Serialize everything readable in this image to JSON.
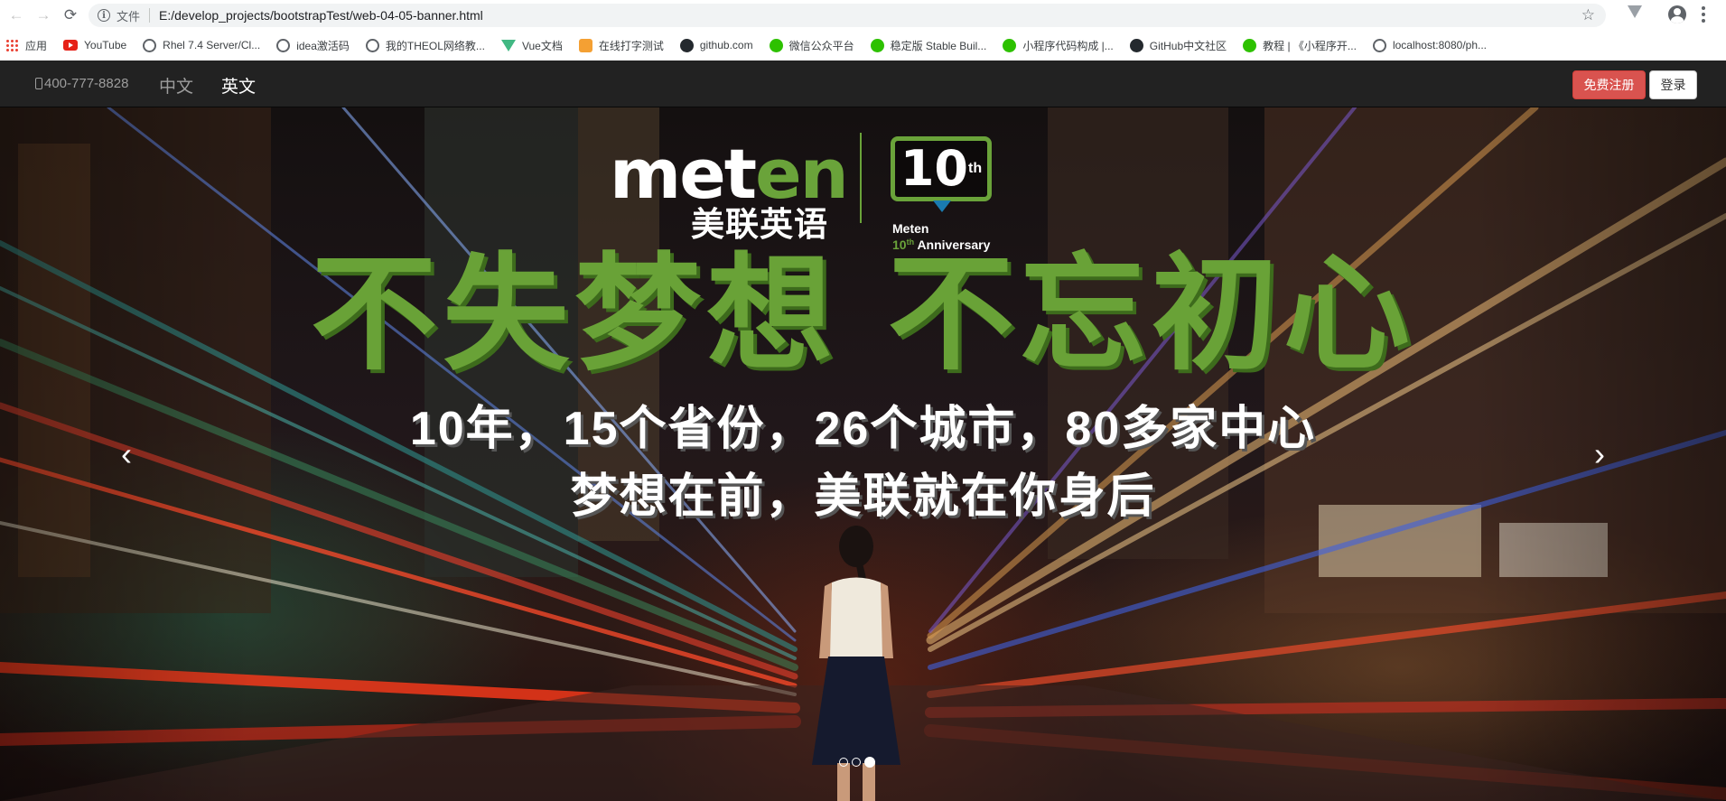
{
  "browser": {
    "url_scheme": "文件",
    "url": "E:/develop_projects/bootstrapTest/web-04-05-banner.html"
  },
  "bookmarks": [
    {
      "label": "应用",
      "icon": "apps-grid-icon"
    },
    {
      "label": "YouTube",
      "icon": "youtube-icon"
    },
    {
      "label": "Rhel 7.4 Server/Cl...",
      "icon": "globe-icon"
    },
    {
      "label": "idea激活码",
      "icon": "globe-icon"
    },
    {
      "label": "我的THEOL网络教...",
      "icon": "globe-icon"
    },
    {
      "label": "Vue文档",
      "icon": "vue-icon"
    },
    {
      "label": "在线打字测试",
      "icon": "typing-icon"
    },
    {
      "label": "github.com",
      "icon": "github-icon"
    },
    {
      "label": "微信公众平台",
      "icon": "wechat-icon"
    },
    {
      "label": "稳定版 Stable Buil...",
      "icon": "wechat-icon"
    },
    {
      "label": "小程序代码构成 |...",
      "icon": "wechat-icon"
    },
    {
      "label": "GitHub中文社区",
      "icon": "github-icon"
    },
    {
      "label": "教程 | 《小程序开...",
      "icon": "wechat-icon"
    },
    {
      "label": "localhost:8080/ph...",
      "icon": "globe-icon"
    }
  ],
  "navbar": {
    "phone": "400-777-8828",
    "lang_zh": "中文",
    "lang_en": "英文",
    "register_label": "免费注册",
    "login_label": "登录"
  },
  "banner": {
    "logo_text_white": "met",
    "logo_text_green": "en",
    "logo_cn": "美联英语",
    "badge_number": "10",
    "badge_suffix": "th",
    "anniversary_line1": "Meten",
    "anniversary_line2_num": "10",
    "anniversary_line2_suffix": "th",
    "anniversary_line2_text": " Anniversary",
    "slogan": "不失梦想 不忘初心",
    "subline1": "10年，15个省份，26个城市，80多家中心",
    "subline2": "梦想在前，美联就在你身后",
    "prev_glyph": "‹",
    "next_glyph": "›",
    "slide_count": 3,
    "active_slide": 3
  }
}
